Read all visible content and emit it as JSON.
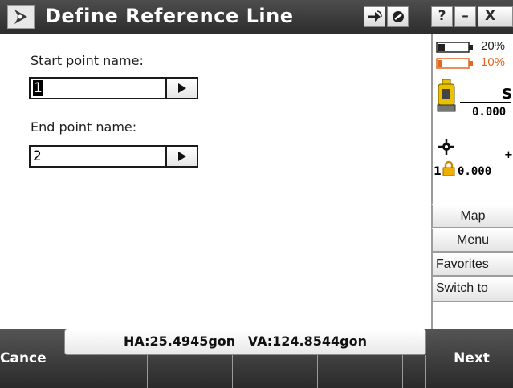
{
  "window": {
    "title": "Define Reference Line",
    "icons": [
      "compass-rose-icon",
      "import-arrow-icon",
      "settings-icon"
    ],
    "controls": {
      "help": "?",
      "minimize": "–",
      "close": "X"
    }
  },
  "form": {
    "start": {
      "label": "Start point name:",
      "value": "1"
    },
    "end": {
      "label": "End point name:",
      "value": "2"
    }
  },
  "status": {
    "battery1": "20%",
    "battery2": "10%",
    "battery2_color": "#e06820",
    "instrument_letter": "S",
    "instrument_value": "0.000",
    "target_offset": "+0",
    "target_value": "0.000",
    "target_number": "1"
  },
  "side_buttons": {
    "map": "Map",
    "menu": "Menu",
    "favorites": "Favorites",
    "switch_to": "Switch to"
  },
  "bottom": {
    "cancel": "Cance",
    "next": "Next",
    "ha": "HA:25.4945gon",
    "va": "VA:124.8544gon"
  }
}
